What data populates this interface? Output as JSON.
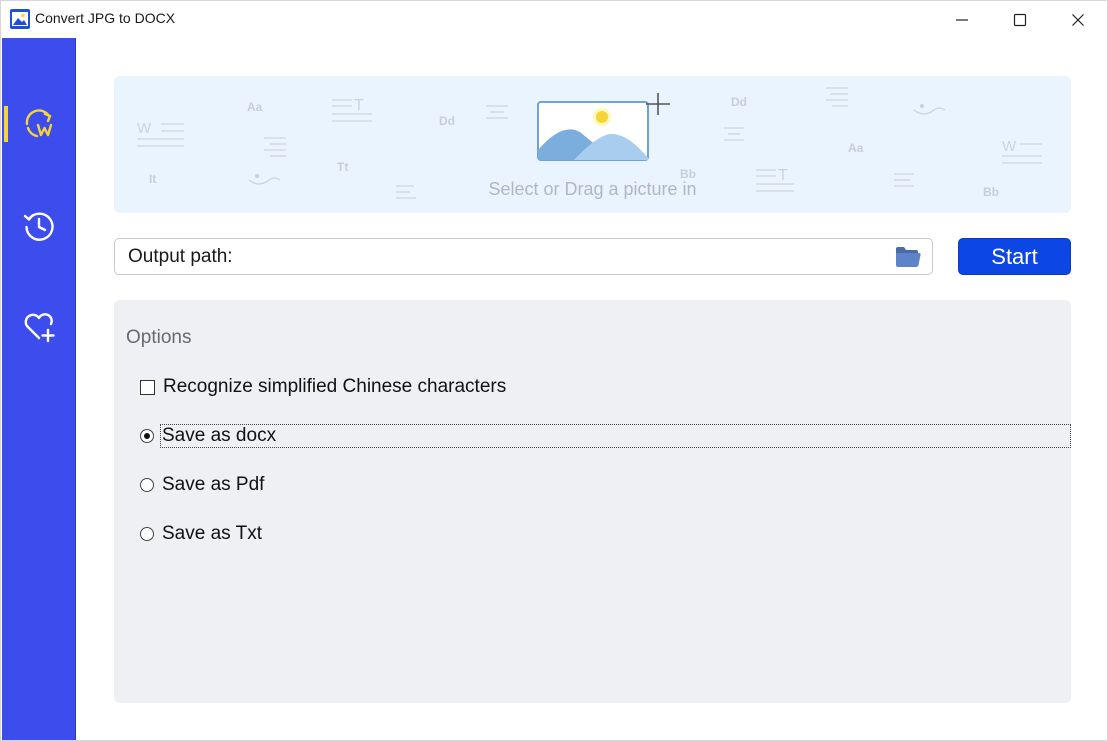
{
  "window": {
    "title": "Convert JPG to DOCX",
    "icons": {
      "app": "app-image-icon",
      "minimize": "minimize-icon",
      "maximize": "maximize-icon",
      "close": "close-icon"
    }
  },
  "sidebar": {
    "items": [
      {
        "icon": "convert-word-icon",
        "active": true
      },
      {
        "icon": "history-icon",
        "active": false
      },
      {
        "icon": "heart-plus-icon",
        "active": false
      }
    ]
  },
  "dropzone": {
    "hint": "Select or Drag a picture in",
    "decorations": [
      "Aa",
      "Dd",
      "Tt",
      "It",
      "Bb",
      "Dd",
      "Aa",
      "Bb"
    ]
  },
  "output": {
    "label": "Output path:",
    "icon": "folder-icon"
  },
  "start_button": {
    "label": "Start"
  },
  "options": {
    "title": "Options",
    "checkbox": {
      "label": "Recognize simplified Chinese characters",
      "checked": false
    },
    "radios": [
      {
        "label": "Save as docx",
        "checked": true
      },
      {
        "label": "Save as Pdf",
        "checked": false
      },
      {
        "label": "Save as Txt",
        "checked": false
      }
    ]
  },
  "colors": {
    "sidebar": "#3d4ded",
    "accent_bar": "#f6d43a",
    "start_button": "#0c47e6",
    "dropzone_bg": "#eaf4fe",
    "options_bg": "#eef0f3"
  }
}
